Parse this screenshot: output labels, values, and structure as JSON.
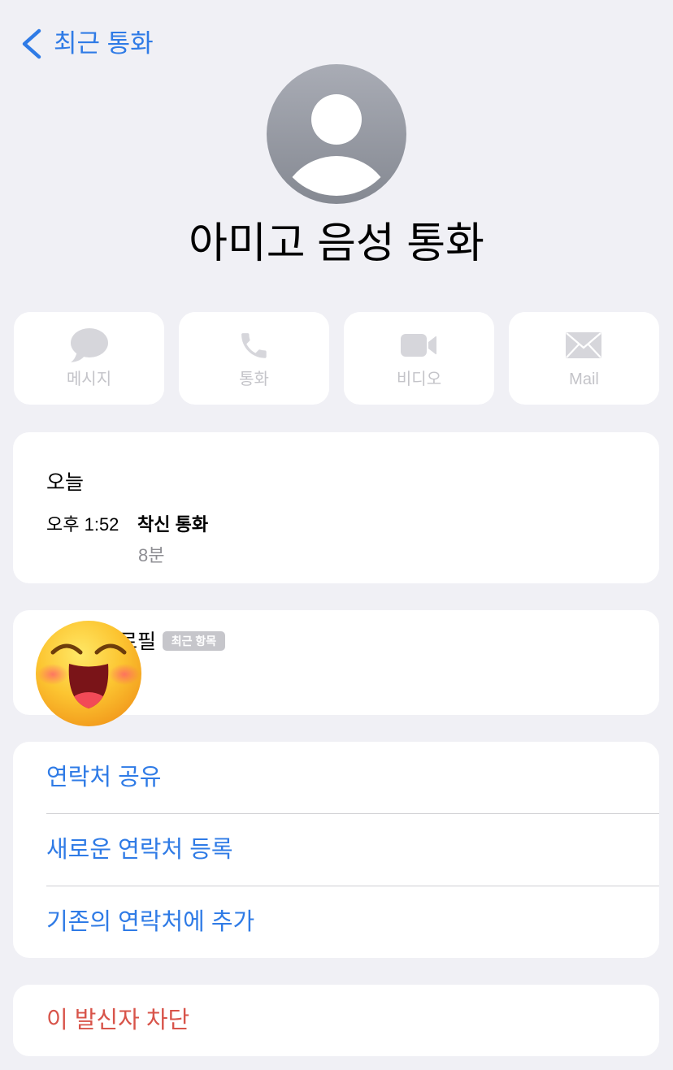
{
  "nav": {
    "back_label": "최근 통화",
    "back_icon": "chevron-left-icon"
  },
  "contact": {
    "name": "아미고 음성 통화",
    "avatar_icon": "person-silhouette-icon"
  },
  "actions": [
    {
      "label": "메시지",
      "icon": "message-bubble-icon"
    },
    {
      "label": "통화",
      "icon": "phone-icon"
    },
    {
      "label": "비디오",
      "icon": "video-camera-icon"
    },
    {
      "label": "Mail",
      "icon": "envelope-icon"
    }
  ],
  "call_history": {
    "day": "오늘",
    "entries": [
      {
        "time": "오후 1:52",
        "type": "착신 통화",
        "duration": "8분"
      }
    ]
  },
  "profile": {
    "label": "로필",
    "badge": "최근 항목"
  },
  "contact_actions": [
    {
      "label": "연락처 공유"
    },
    {
      "label": "새로운 연락처 등록"
    },
    {
      "label": "기존의 연락처에 추가"
    }
  ],
  "block": {
    "label": "이 발신자 차단"
  },
  "overlay": {
    "icon": "smiling-face-with-blush-emoji"
  },
  "colors": {
    "background": "#f0f0f5",
    "card": "#ffffff",
    "accent": "#2f7be6",
    "destructive": "#d8544a",
    "secondary_text": "#8e8e93",
    "disabled_label": "#c4c4c9",
    "disabled_icon": "#d6d6db",
    "badge": "#c6c6cb"
  }
}
